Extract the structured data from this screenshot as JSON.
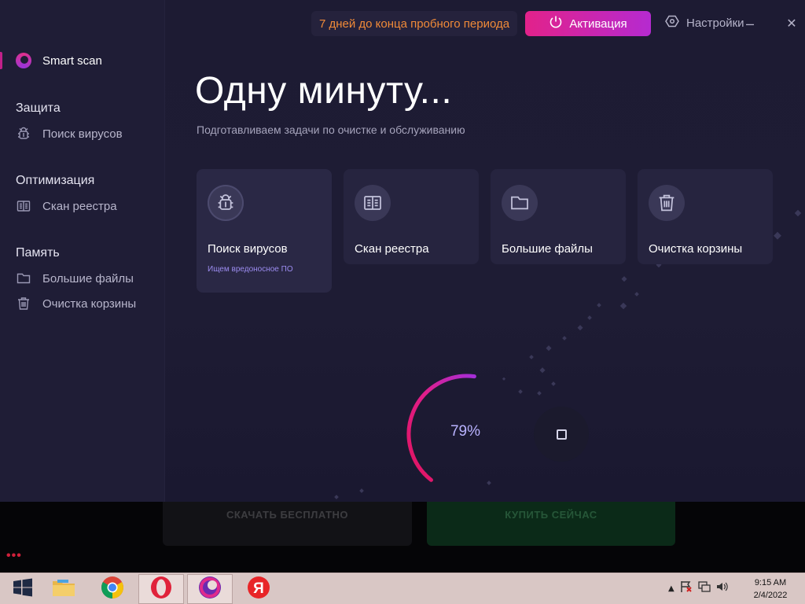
{
  "background_page": {
    "download_label": "СКАЧАТЬ БЕСПЛАТНО",
    "buy_label": "КУПИТЬ СЕЙЧАС",
    "dots": "•••"
  },
  "topbar": {
    "trial_text": "7 дней до конца пробного периода",
    "activate_label": "Активация",
    "settings_label": "Настройки",
    "minimize": "–",
    "close": "✕"
  },
  "sidebar": {
    "brand_label": "Smart scan",
    "sections": [
      {
        "title": "Защита",
        "items": [
          {
            "label": "Поиск вирусов",
            "icon": "bug-icon"
          }
        ]
      },
      {
        "title": "Оптимизация",
        "items": [
          {
            "label": "Скан реестра",
            "icon": "book-icon"
          }
        ]
      },
      {
        "title": "Память",
        "items": [
          {
            "label": "Большие файлы",
            "icon": "folder-icon"
          },
          {
            "label": "Очистка корзины",
            "icon": "trash-icon"
          }
        ]
      }
    ]
  },
  "main": {
    "title": "Одну минуту...",
    "subtitle": "Подготавливаем задачи по очистке и обслуживанию",
    "cards": [
      {
        "label": "Поиск вирусов",
        "status": "Ищем вредоносное ПО",
        "icon": "bug-icon",
        "active": true
      },
      {
        "label": "Скан реестра",
        "status": "",
        "icon": "book-icon",
        "active": false
      },
      {
        "label": "Большие файлы",
        "status": "",
        "icon": "folder-icon",
        "active": false
      },
      {
        "label": "Очистка корзины",
        "status": "",
        "icon": "trash-icon",
        "active": false
      }
    ],
    "progress": {
      "value": 79,
      "label": "79%"
    }
  },
  "taskbar": {
    "apps": [
      {
        "name": "start-button",
        "icon": "windows-icon"
      },
      {
        "name": "file-explorer",
        "icon": "folder-icon"
      },
      {
        "name": "chrome",
        "icon": "chrome-icon"
      },
      {
        "name": "opera",
        "icon": "opera-icon"
      },
      {
        "name": "smart-scan",
        "icon": "smart-scan-icon"
      },
      {
        "name": "yandex",
        "icon": "yandex-icon"
      }
    ],
    "clock_time": "9:15 AM",
    "clock_date": "2/4/2022"
  },
  "colors": {
    "accent_pink": "#e2228a",
    "accent_purple": "#b52ad0",
    "trial_orange": "#f08a38",
    "app_background": "#1e1c34"
  }
}
